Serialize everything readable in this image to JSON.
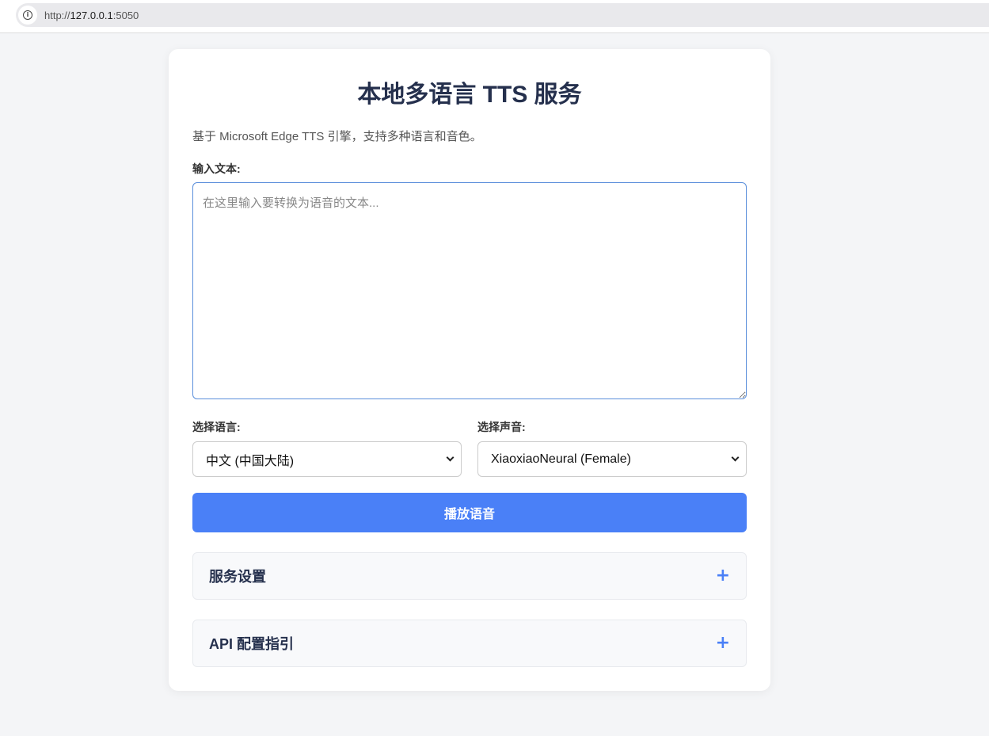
{
  "browser": {
    "url_prefix": "http://",
    "url_host": "127.0.0.1",
    "url_port": ":5050"
  },
  "page": {
    "title": "本地多语言 TTS 服务",
    "subtitle": "基于 Microsoft Edge TTS 引擎，支持多种语言和音色。"
  },
  "text_input": {
    "label": "输入文本:",
    "placeholder": "在这里输入要转换为语音的文本...",
    "value": ""
  },
  "language_select": {
    "label": "选择语言:",
    "selected": "中文 (中国大陆)"
  },
  "voice_select": {
    "label": "选择声音:",
    "selected": "XiaoxiaoNeural (Female)"
  },
  "play_button": {
    "label": "播放语音"
  },
  "accordions": [
    {
      "title": "服务设置",
      "toggle": "+"
    },
    {
      "title": "API 配置指引",
      "toggle": "+"
    }
  ],
  "colors": {
    "accent": "#4a80f7",
    "title": "#25304d",
    "background": "#f4f5f7"
  },
  "icons": {
    "site_info": "info-icon",
    "select_arrow": "chevron-down-icon",
    "expand": "plus-icon"
  }
}
